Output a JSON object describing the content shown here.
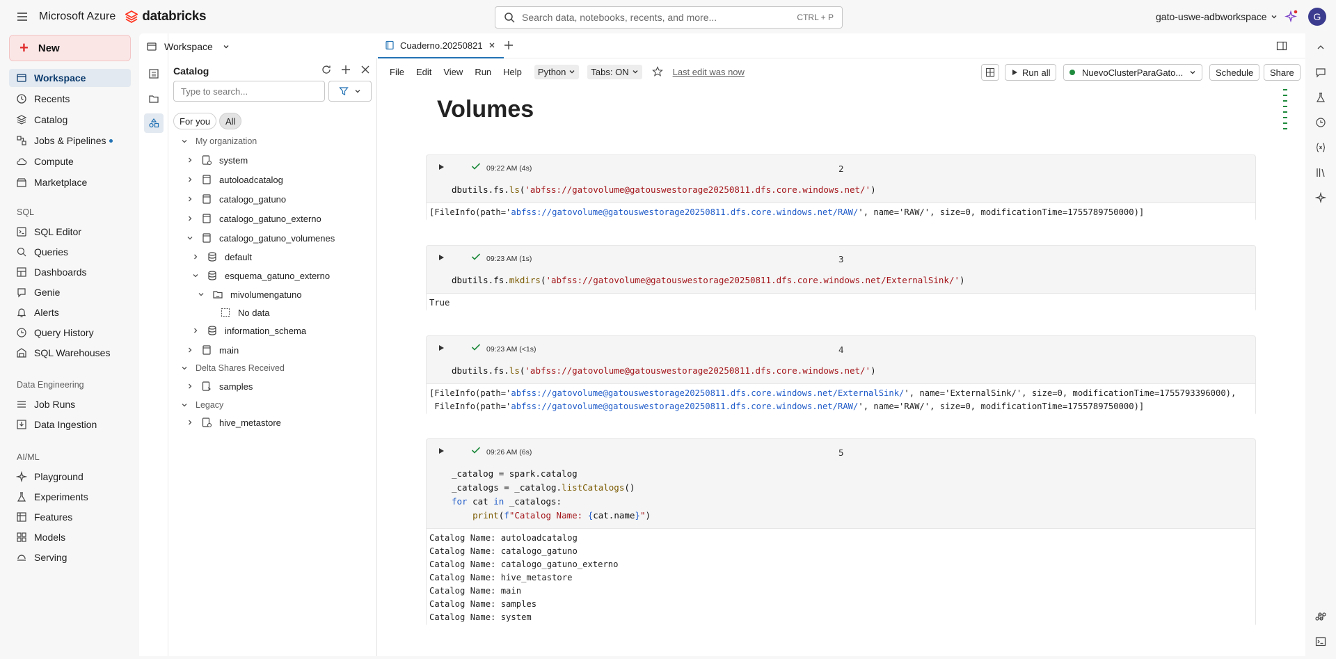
{
  "topbar": {
    "app_title": "Microsoft Azure",
    "brand": "databricks",
    "search_placeholder": "Search data, notebooks, recents, and more...",
    "search_shortcut": "CTRL + P",
    "workspace_name": "gato-uswe-adbworkspace",
    "avatar_initial": "G"
  },
  "leftnav": {
    "new_label": "New",
    "items": [
      {
        "label": "Workspace",
        "icon": "workspace-icon",
        "active": true
      },
      {
        "label": "Recents",
        "icon": "clock-icon"
      },
      {
        "label": "Catalog",
        "icon": "catalog-icon"
      },
      {
        "label": "Jobs & Pipelines",
        "icon": "jobs-icon",
        "badge": true
      },
      {
        "label": "Compute",
        "icon": "cloud-icon"
      },
      {
        "label": "Marketplace",
        "icon": "marketplace-icon"
      }
    ],
    "sql_section": "SQL",
    "sql_items": [
      "SQL Editor",
      "Queries",
      "Dashboards",
      "Genie",
      "Alerts",
      "Query History",
      "SQL Warehouses"
    ],
    "de_section": "Data Engineering",
    "de_items": [
      "Job Runs",
      "Data Ingestion"
    ],
    "ml_section": "AI/ML",
    "ml_items": [
      "Playground",
      "Experiments",
      "Features",
      "Models",
      "Serving"
    ]
  },
  "workspace_header": {
    "label": "Workspace"
  },
  "catalog": {
    "title": "Catalog",
    "search_placeholder": "Type to search...",
    "pill_for_you": "For you",
    "pill_all": "All",
    "org_section": "My organization",
    "tree": [
      {
        "label": "system",
        "level": 1
      },
      {
        "label": "autoloadcatalog",
        "level": 1
      },
      {
        "label": "catalogo_gatuno",
        "level": 1
      },
      {
        "label": "catalogo_gatuno_externo",
        "level": 1
      },
      {
        "label": "catalogo_gatuno_volumenes",
        "level": 1,
        "expanded": true
      },
      {
        "label": "default",
        "level": 2
      },
      {
        "label": "esquema_gatuno_externo",
        "level": 2,
        "expanded": true
      },
      {
        "label": "mivolumengatuno",
        "level": 3,
        "expanded": true
      },
      {
        "label": "No data",
        "level": 4
      },
      {
        "label": "information_schema",
        "level": 2
      },
      {
        "label": "main",
        "level": 1
      }
    ],
    "delta_section": "Delta Shares Received",
    "delta_items": [
      "samples"
    ],
    "legacy_section": "Legacy",
    "legacy_items": [
      "hive_metastore"
    ]
  },
  "notebook": {
    "tab_name": "Cuaderno.20250821",
    "menu": [
      "File",
      "Edit",
      "View",
      "Run",
      "Help"
    ],
    "language": "Python",
    "tabs_setting": "Tabs: ON",
    "last_edit": "Last edit was now",
    "run_all": "Run all",
    "cluster": "NuevoClusterParaGato...",
    "schedule": "Schedule",
    "share": "Share",
    "title": "Volumes",
    "cells": [
      {
        "time": "09:22 AM (4s)",
        "number": "2",
        "code": "dbutils.fs.ls('abfss://gatovolume@gatouswestorage20250811.dfs.core.windows.net/')",
        "output": "[FileInfo(path='abfss://gatovolume@gatouswestorage20250811.dfs.core.windows.net/RAW/', name='RAW/', size=0, modificationTime=1755789750000)]"
      },
      {
        "time": "09:23 AM (1s)",
        "number": "3",
        "code": "dbutils.fs.mkdirs('abfss://gatovolume@gatouswestorage20250811.dfs.core.windows.net/ExternalSink/')",
        "output": "True"
      },
      {
        "time": "09:23 AM (<1s)",
        "number": "4",
        "code": "dbutils.fs.ls('abfss://gatovolume@gatouswestorage20250811.dfs.core.windows.net/')",
        "output_line1": "[FileInfo(path='abfss://gatovolume@gatouswestorage20250811.dfs.core.windows.net/ExternalSink/', name='ExternalSink/', size=0, modificationTime=1755793396000),",
        "output_line2": " FileInfo(path='abfss://gatovolume@gatouswestorage20250811.dfs.core.windows.net/RAW/', name='RAW/', size=0, modificationTime=1755789750000)]"
      },
      {
        "time": "09:26 AM (6s)",
        "number": "5",
        "code_lines": [
          "_catalog = spark.catalog",
          "_catalogs = _catalog.listCatalogs()",
          "for cat in _catalogs:",
          "    print(f\"Catalog Name: {cat.name}\")"
        ],
        "output_lines": [
          "Catalog Name: autoloadcatalog",
          "Catalog Name: catalogo_gatuno",
          "Catalog Name: catalogo_gatuno_externo",
          "Catalog Name: hive_metastore",
          "Catalog Name: main",
          "Catalog Name: samples",
          "Catalog Name: system"
        ]
      }
    ]
  },
  "colors": {
    "accent": "#2272b4",
    "brand_red": "#e02f2f",
    "string": "#a3151a",
    "keyword": "#1f5bc9",
    "success": "#1e8a3c"
  }
}
